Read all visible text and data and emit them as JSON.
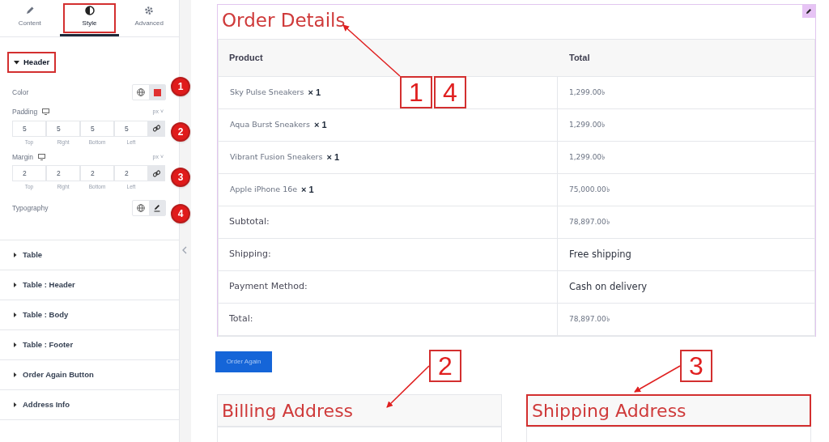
{
  "panel": {
    "tabs": [
      {
        "label": "Content",
        "selected": false
      },
      {
        "label": "Style",
        "selected": true
      },
      {
        "label": "Advanced",
        "selected": false
      }
    ],
    "section": {
      "title": "Header",
      "expanded": true
    },
    "color": {
      "label": "Color"
    },
    "padding": {
      "label": "Padding",
      "unit": "px ˅",
      "values": [
        {
          "value": "5",
          "label": "Top"
        },
        {
          "value": "5",
          "label": "Right"
        },
        {
          "value": "5",
          "label": "Bottom"
        },
        {
          "value": "5",
          "label": "Left"
        }
      ]
    },
    "margin": {
      "label": "Margin",
      "unit": "px ˅",
      "values": [
        {
          "value": "2",
          "label": "Top"
        },
        {
          "value": "2",
          "label": "Right"
        },
        {
          "value": "2",
          "label": "Bottom"
        },
        {
          "value": "2",
          "label": "Left"
        }
      ]
    },
    "typography": {
      "label": "Typography"
    },
    "sections": [
      "Table",
      "Table : Header",
      "Table : Body",
      "Table : Footer",
      "Order Again Button",
      "Address Info"
    ]
  },
  "order": {
    "title": "Order Details",
    "columns": [
      "Product",
      "Total"
    ],
    "items": [
      {
        "name": "Sky Pulse Sneakers",
        "qty": "× 1",
        "total": "1,299.00৳"
      },
      {
        "name": "Aqua Burst Sneakers",
        "qty": "× 1",
        "total": "1,299.00৳"
      },
      {
        "name": "Vibrant Fusion Sneakers",
        "qty": "× 1",
        "total": "1,299.00৳"
      },
      {
        "name": "Apple iPhone 16e",
        "qty": "× 1",
        "total": "75,000.00৳"
      }
    ],
    "totals": [
      {
        "label": "Subtotal:",
        "value": "78,897.00৳",
        "kind": "amount"
      },
      {
        "label": "Shipping:",
        "value": "Free shipping",
        "kind": "text"
      },
      {
        "label": "Payment Method:",
        "value": "Cash on delivery",
        "kind": "text"
      },
      {
        "label": "Total:",
        "value": "78,897.00৳",
        "kind": "amount"
      }
    ],
    "button": "Order Again"
  },
  "addresses": [
    {
      "title": "Billing Address",
      "highlighted": false
    },
    {
      "title": "Shipping Address",
      "highlighted": true
    }
  ],
  "annotations": {
    "badges": [
      "1",
      "2",
      "3",
      "4"
    ],
    "callouts": [
      "1",
      "4",
      "2",
      "3"
    ]
  }
}
